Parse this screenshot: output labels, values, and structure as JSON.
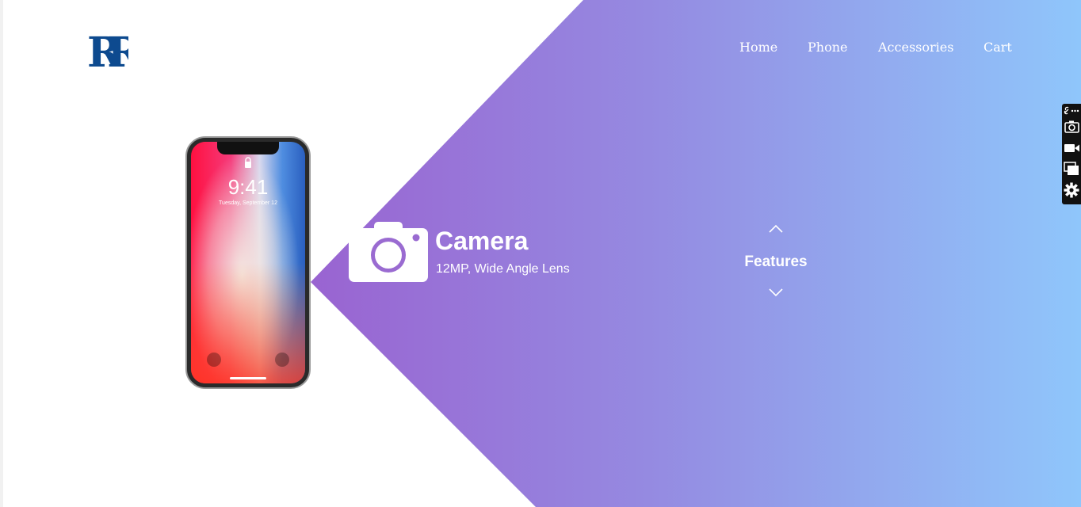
{
  "brand": {
    "logo_text": "RR",
    "logo_color": "#0d4a8f"
  },
  "nav": {
    "items": [
      {
        "label": "Home"
      },
      {
        "label": "Phone"
      },
      {
        "label": "Accessories"
      },
      {
        "label": "Cart"
      }
    ]
  },
  "hero": {
    "gradient_start": "#9b54c9",
    "gradient_end": "#8fc6fb",
    "phone": {
      "time": "9:41",
      "date": "Tuesday, September 12"
    },
    "feature": {
      "icon": "camera-icon",
      "title": "Camera",
      "description": "12MP, Wide Angle Lens"
    },
    "features_nav": {
      "label": "Features",
      "up_icon": "chevron-up-icon",
      "down_icon": "chevron-down-icon"
    }
  },
  "side_toolbar": {
    "tools": [
      "link-more-icon",
      "camera-icon",
      "video-icon",
      "windows-icon",
      "gear-icon"
    ]
  }
}
